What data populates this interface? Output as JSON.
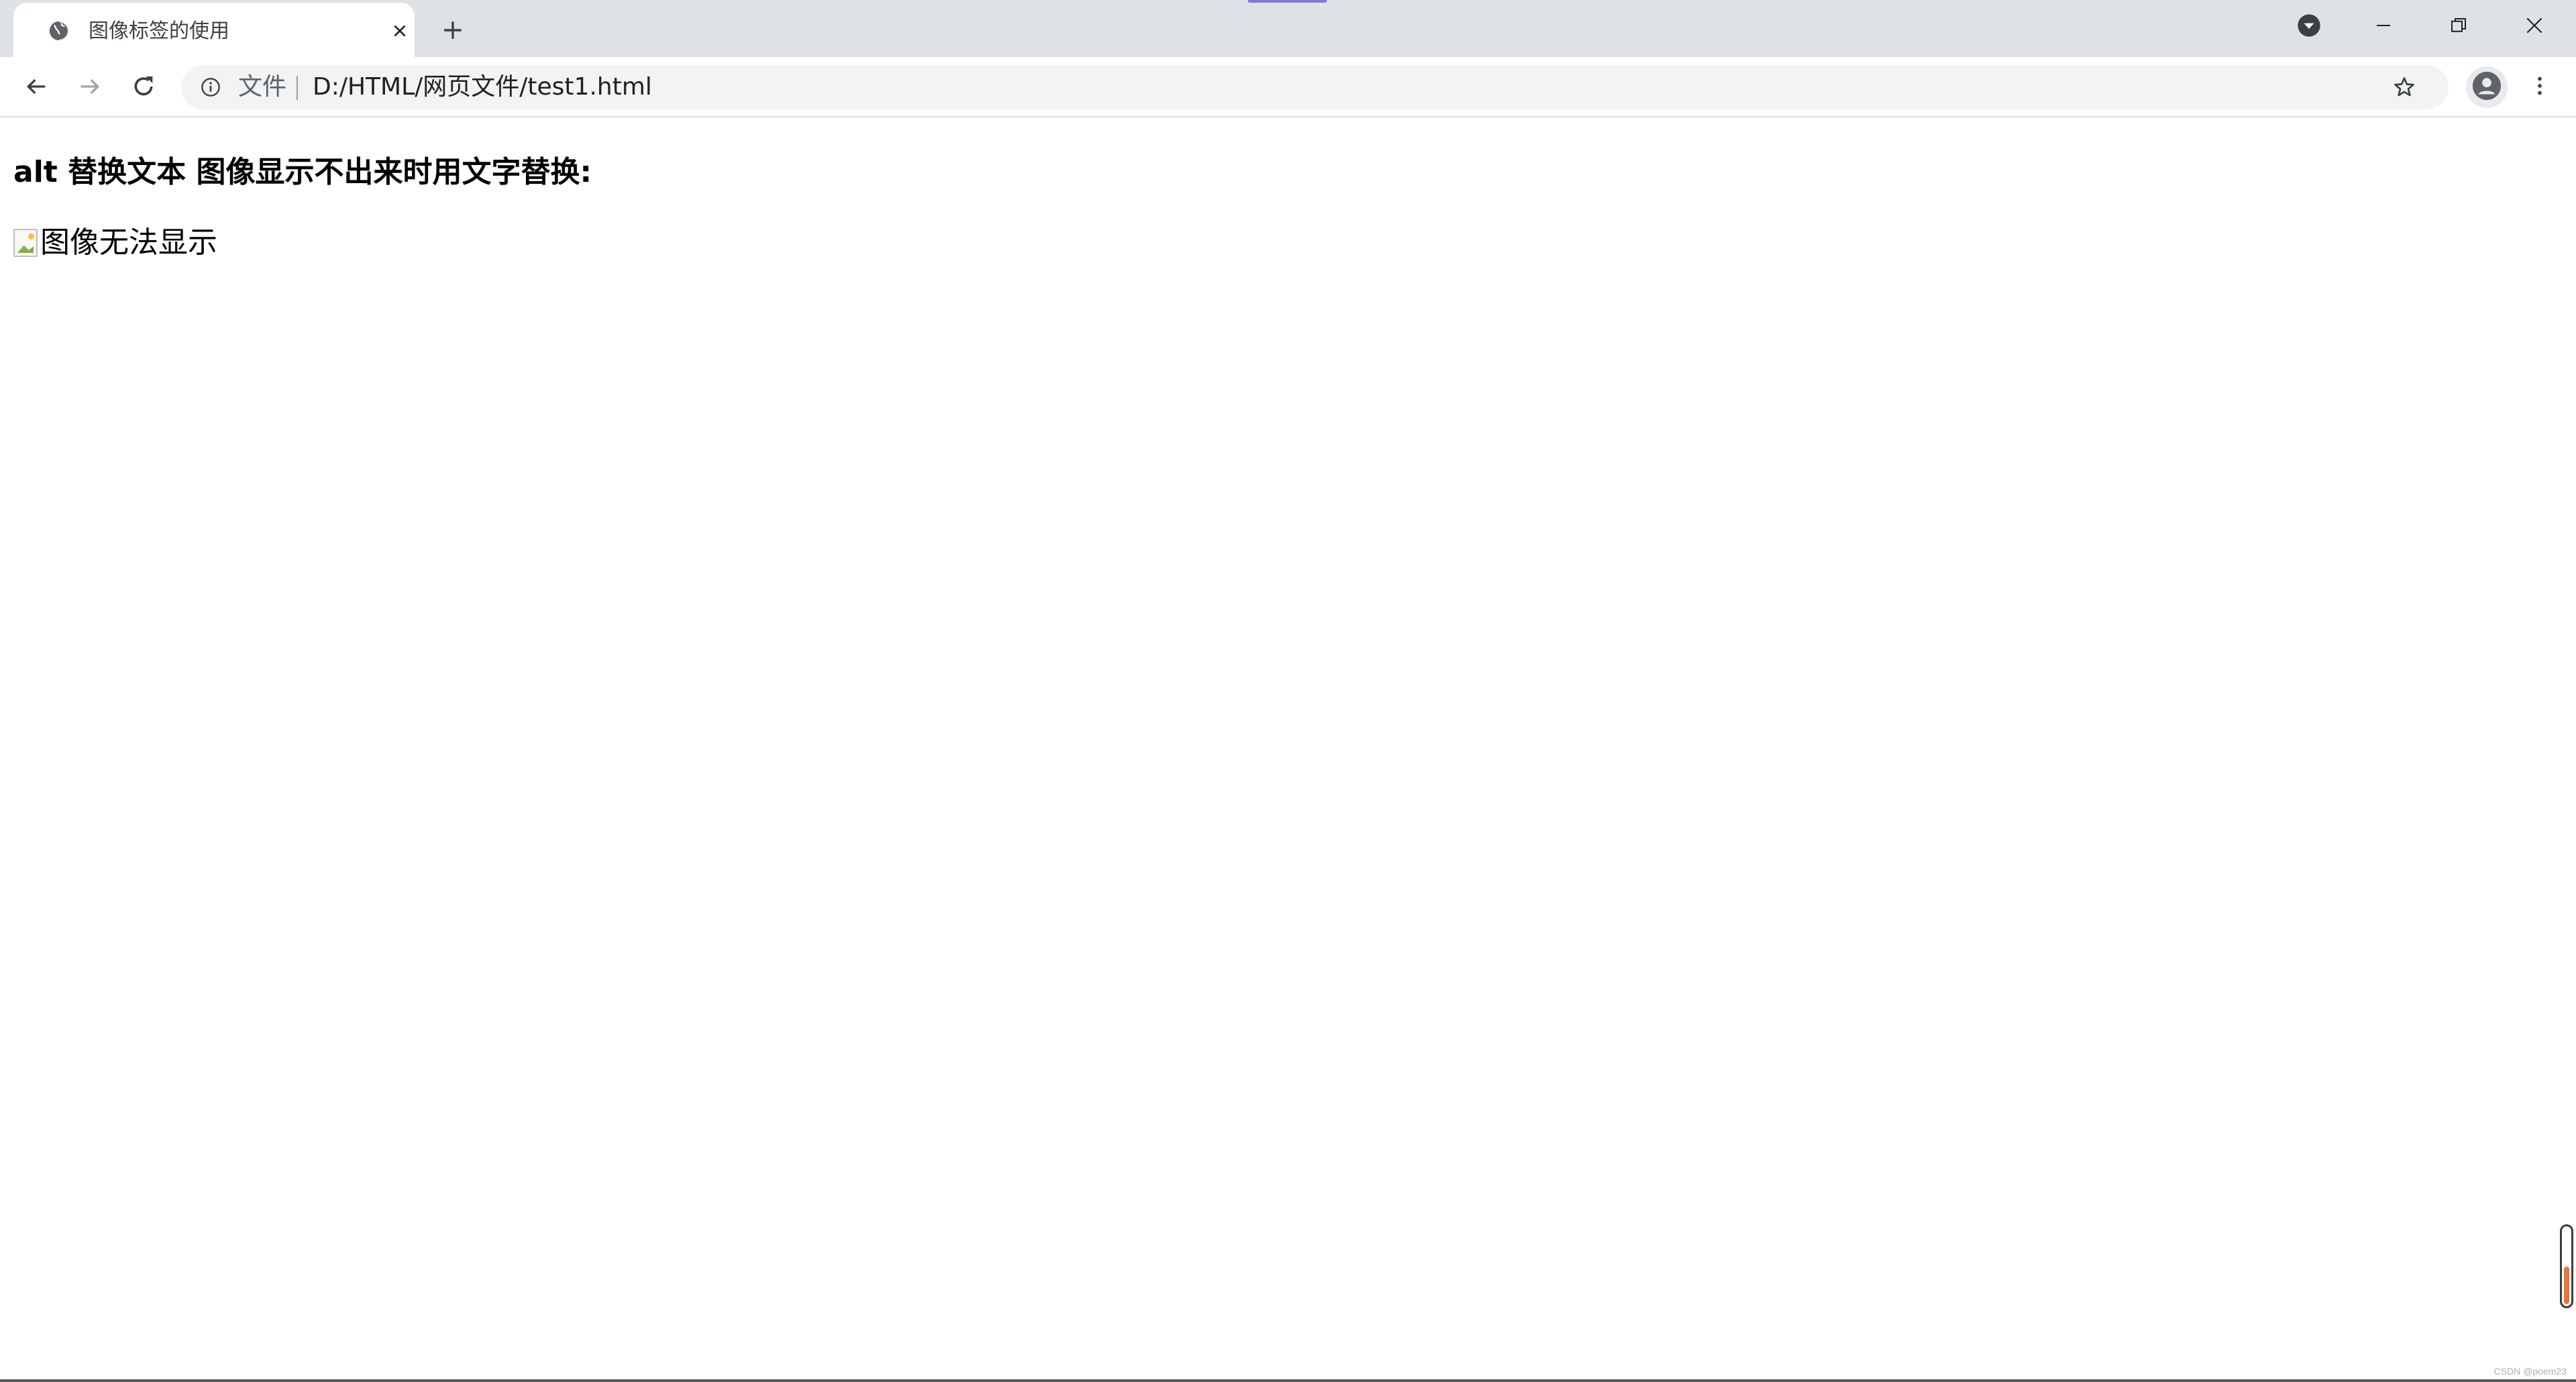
{
  "browser": {
    "tab": {
      "title": "图像标签的使用",
      "favicon": "globe-icon",
      "close_icon": "close-icon"
    },
    "new_tab_icon": "plus-icon",
    "window_controls": {
      "profile_menu_icon": "chevron-down-icon",
      "minimize_icon": "minimize-icon",
      "restore_icon": "restore-icon",
      "close_icon": "close-icon"
    },
    "toolbar": {
      "back_icon": "arrow-left-icon",
      "forward_icon": "arrow-right-icon",
      "reload_icon": "reload-icon",
      "site_info_icon": "info-icon",
      "scheme_label": "文件",
      "url": "D:/HTML/网页文件/test1.html",
      "bookmark_icon": "star-icon",
      "profile_icon": "person-icon",
      "menu_icon": "kebab-menu-icon"
    }
  },
  "page": {
    "heading": "alt 替换文本 图像显示不出来时用文字替换:",
    "image_alt_text": "图像无法显示"
  },
  "overlay": {
    "watermark": "CSDN @poem23"
  },
  "colors": {
    "tabstrip_bg": "#dee1e6",
    "omnibox_bg": "#f1f3f4",
    "top_indicator": "#7c7fd4",
    "scroll_fill": "#e8743b"
  }
}
